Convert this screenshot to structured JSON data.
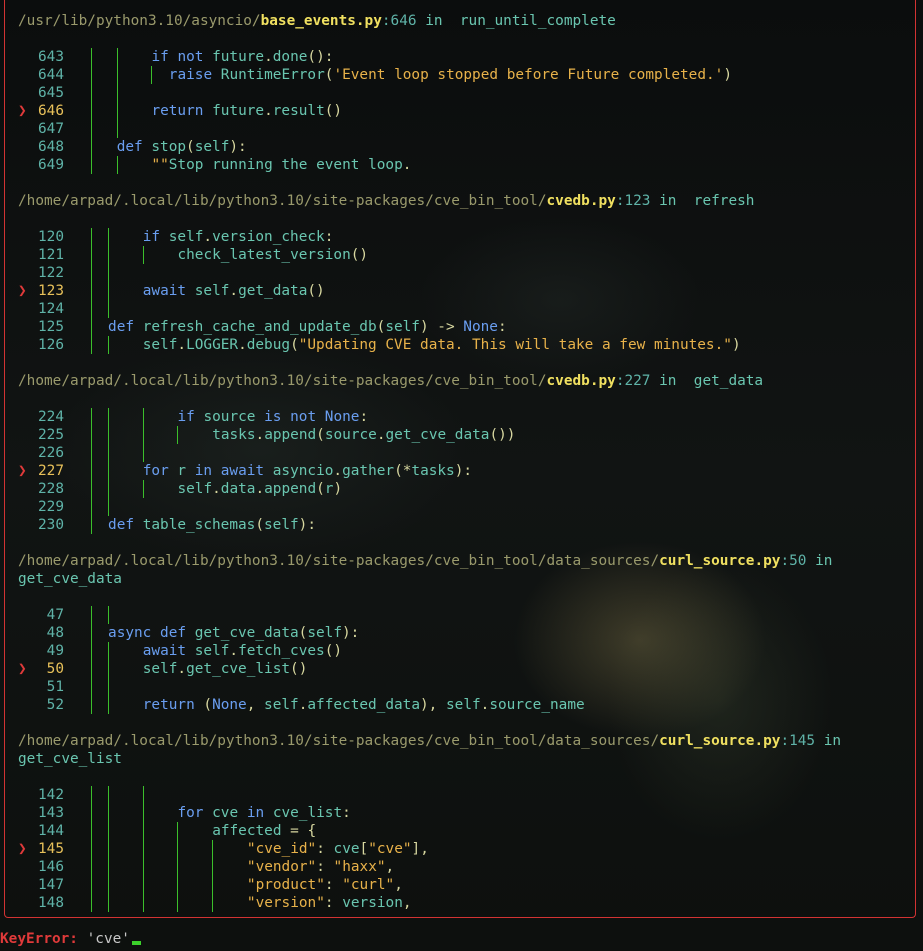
{
  "frames": [
    {
      "path_dim": "/usr/lib/python3.10/asyncio/",
      "file": "base_events.py",
      "lineno": ":646",
      "in": " in ",
      "func": "run_until_complete",
      "lines": [
        {
          "n": "643",
          "code": "if not future.done():"
        },
        {
          "n": "644",
          "code": "raise RuntimeError('Event loop stopped before Future completed.')"
        },
        {
          "n": "645",
          "code": ""
        },
        {
          "n": "646",
          "code": "return future.result()",
          "hl": true
        },
        {
          "n": "647",
          "code": ""
        },
        {
          "n": "648",
          "code": "def stop(self):"
        },
        {
          "n": "649",
          "code": "\"\"\"Stop running the event loop."
        }
      ]
    },
    {
      "path_dim": "/home/arpad/.local/lib/python3.10/site-packages/cve_bin_tool/",
      "file": "cvedb.py",
      "lineno": ":123",
      "in": " in ",
      "func": "refresh",
      "lines": [
        {
          "n": "120",
          "code": "if self.version_check:"
        },
        {
          "n": "121",
          "code": "check_latest_version()"
        },
        {
          "n": "122",
          "code": ""
        },
        {
          "n": "123",
          "code": "await self.get_data()",
          "hl": true
        },
        {
          "n": "124",
          "code": ""
        },
        {
          "n": "125",
          "code": "def refresh_cache_and_update_db(self) -> None:"
        },
        {
          "n": "126",
          "code": "self.LOGGER.debug(\"Updating CVE data. This will take a few minutes.\")"
        }
      ]
    },
    {
      "path_dim": "/home/arpad/.local/lib/python3.10/site-packages/cve_bin_tool/",
      "file": "cvedb.py",
      "lineno": ":227",
      "in": " in ",
      "func": "get_data",
      "lines": [
        {
          "n": "224",
          "code": "if source is not None:"
        },
        {
          "n": "225",
          "code": "tasks.append(source.get_cve_data())"
        },
        {
          "n": "226",
          "code": ""
        },
        {
          "n": "227",
          "code": "for r in await asyncio.gather(*tasks):",
          "hl": true
        },
        {
          "n": "228",
          "code": "self.data.append(r)"
        },
        {
          "n": "229",
          "code": ""
        },
        {
          "n": "230",
          "code": "def table_schemas(self):"
        }
      ]
    },
    {
      "path_dim": "/home/arpad/.local/lib/python3.10/site-packages/cve_bin_tool/data_sources/",
      "file": "curl_source.py",
      "lineno": ":50",
      "in": " in",
      "func": "get_cve_data",
      "lines": [
        {
          "n": "47",
          "code": ""
        },
        {
          "n": "48",
          "code": "async def get_cve_data(self):"
        },
        {
          "n": "49",
          "code": "await self.fetch_cves()"
        },
        {
          "n": "50",
          "code": "self.get_cve_list()",
          "hl": true
        },
        {
          "n": "51",
          "code": ""
        },
        {
          "n": "52",
          "code": "return (None, self.affected_data), self.source_name"
        }
      ]
    },
    {
      "path_dim": "/home/arpad/.local/lib/python3.10/site-packages/cve_bin_tool/data_sources/",
      "file": "curl_source.py",
      "lineno": ":145",
      "in": " in",
      "func": "get_cve_list",
      "lines": [
        {
          "n": "142",
          "code": ""
        },
        {
          "n": "143",
          "code": "for cve in cve_list:"
        },
        {
          "n": "144",
          "code": "affected = {"
        },
        {
          "n": "145",
          "code": "\"cve_id\": cve[\"cve\"],",
          "hl": true
        },
        {
          "n": "146",
          "code": "\"vendor\": \"haxx\","
        },
        {
          "n": "147",
          "code": "\"product\": \"curl\","
        },
        {
          "n": "148",
          "code": "\"version\": version,"
        }
      ]
    }
  ],
  "marker_glyph": "❯",
  "error": {
    "kind": "KeyError:",
    "message": " 'cve'"
  },
  "colors": {
    "frame_border": "#d23333",
    "guide": "#3bbf2b",
    "highlight_lineno": "#e8c15a",
    "error": "#e03a3a"
  }
}
